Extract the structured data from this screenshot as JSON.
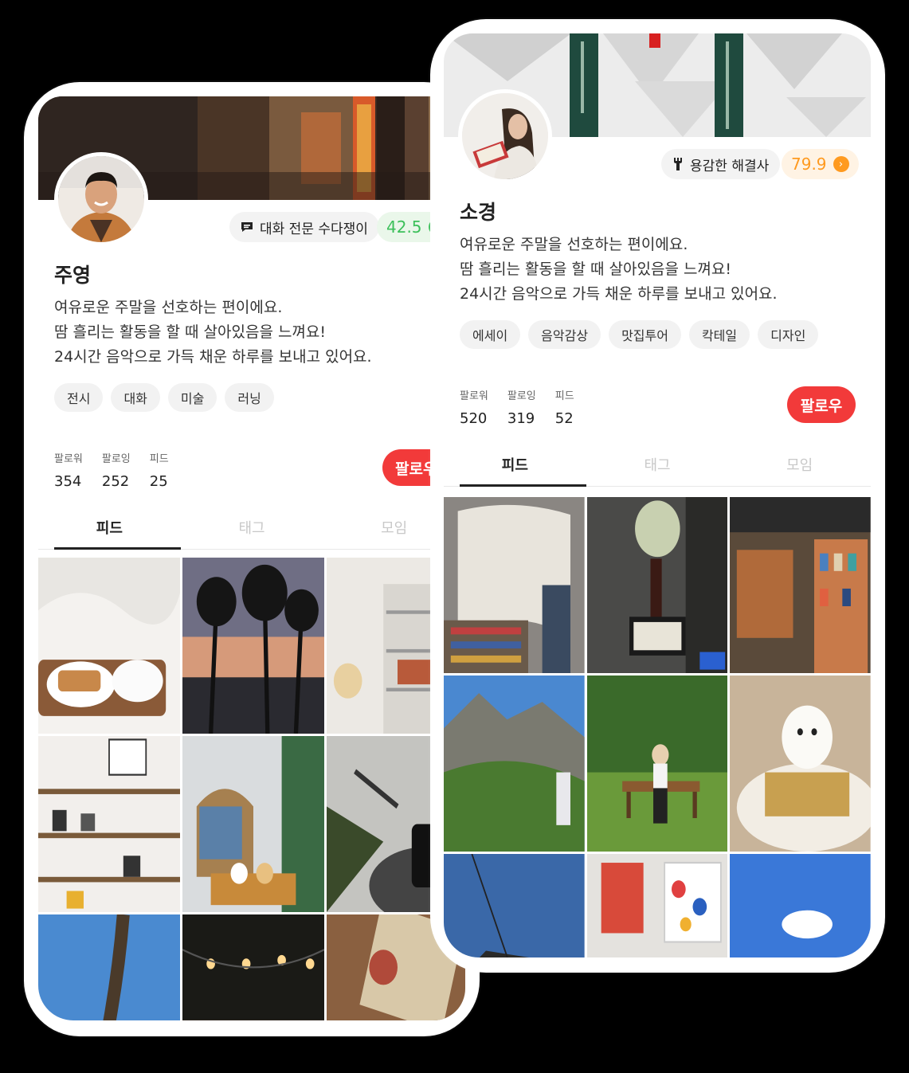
{
  "profile_left": {
    "name": "주영",
    "badge": "대화 전문 수다쟁이",
    "score": "42.5",
    "score_color": "#3cc05a",
    "bio": [
      "여유로운 주말을 선호하는 편이에요.",
      "땀 흘리는 활동을 할 때 살아있음을 느껴요!",
      "24시간 음악으로 가득 채운 하루를 보내고 있어요."
    ],
    "tags": [
      "전시",
      "대화",
      "미술",
      "러닝"
    ],
    "stats": [
      {
        "label": "팔로워",
        "value": "354"
      },
      {
        "label": "팔로잉",
        "value": "252"
      },
      {
        "label": "피드",
        "value": "25"
      }
    ],
    "follow_label": "팔로우",
    "tabs": [
      "피드",
      "태그",
      "모임"
    ]
  },
  "profile_right": {
    "name": "소경",
    "badge": "용감한 해결사",
    "score": "79.9",
    "score_color": "#ff9a1f",
    "bio": [
      "여유로운 주말을 선호하는 편이에요.",
      "땀 흘리는 활동을 할 때 살아있음을 느껴요!",
      "24시간 음악으로 가득 채운 하루를 보내고 있어요."
    ],
    "tags": [
      "에세이",
      "음악감상",
      "맛집투어",
      "칵테일",
      "디자인"
    ],
    "stats": [
      {
        "label": "팔로워",
        "value": "520"
      },
      {
        "label": "팔로잉",
        "value": "319"
      },
      {
        "label": "피드",
        "value": "52"
      }
    ],
    "follow_label": "팔로우",
    "tabs": [
      "피드",
      "태그",
      "모임"
    ]
  },
  "colors": {
    "accent_red": "#f23a3a",
    "green": "#3cc05a",
    "orange": "#ff9a1f"
  },
  "icons": {
    "left_badge": "chat-bubble-icon",
    "right_badge": "wrench-icon",
    "score": "chevron-right-icon"
  }
}
